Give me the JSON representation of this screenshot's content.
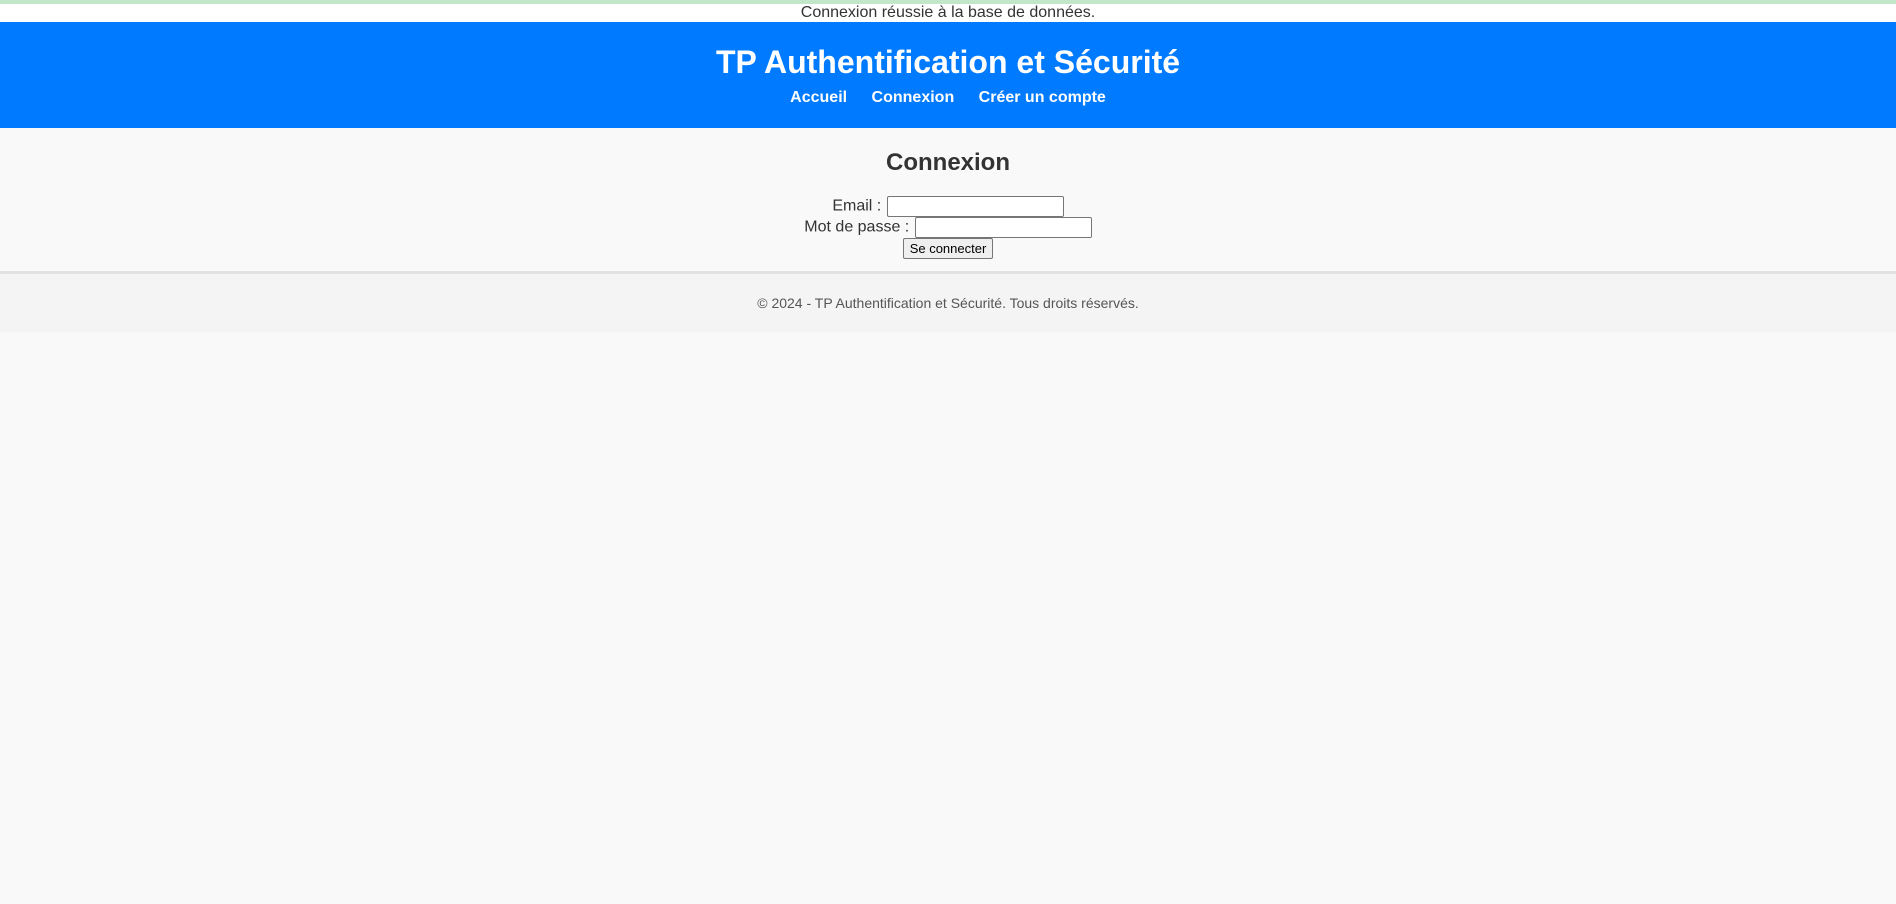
{
  "status_message": "Connexion réussie à la base de données.",
  "header": {
    "title": "TP Authentification et Sécurité",
    "nav": {
      "home": "Accueil",
      "login": "Connexion",
      "register": "Créer un compte"
    }
  },
  "login_form": {
    "heading": "Connexion",
    "email_label": "Email :",
    "email_value": "",
    "password_label": "Mot de passe :",
    "password_value": "",
    "submit_label": "Se connecter"
  },
  "footer": {
    "text": "© 2024 - TP Authentification et Sécurité. Tous droits réservés."
  },
  "colors": {
    "header_background": "#007bff",
    "header_text": "#ffffff",
    "success_border": "#c3e6cb",
    "page_background": "#f9f9f9"
  }
}
